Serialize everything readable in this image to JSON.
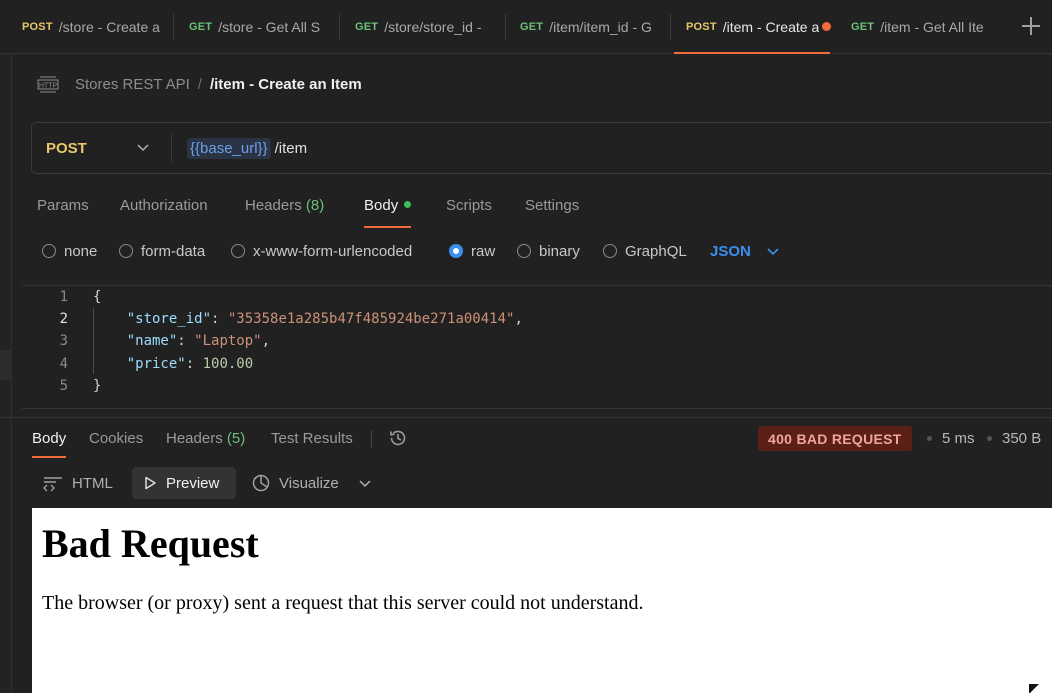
{
  "tabs": [
    {
      "method": "POST",
      "title": "/store - Create a",
      "active": false,
      "unsaved": false
    },
    {
      "method": "GET",
      "title": "/store - Get All S",
      "active": false,
      "unsaved": false
    },
    {
      "method": "GET",
      "title": "/store/store_id -",
      "active": false,
      "unsaved": false
    },
    {
      "method": "GET",
      "title": "/item/item_id - G",
      "active": false,
      "unsaved": false
    },
    {
      "method": "POST",
      "title": "/item - Create a",
      "active": true,
      "unsaved": true
    },
    {
      "method": "GET",
      "title": "/item - Get All Ite",
      "active": false,
      "unsaved": false
    }
  ],
  "breadcrumb": {
    "icon": "http-icon",
    "collection": "Stores REST API",
    "separator": "/",
    "request": "/item - Create an Item"
  },
  "request": {
    "method": "POST",
    "url_variable": "{{base_url}}",
    "url_path": "/item"
  },
  "request_tabs": [
    {
      "label": "Params"
    },
    {
      "label": "Authorization"
    },
    {
      "label": "Headers",
      "count": "(8)"
    },
    {
      "label": "Body",
      "active": true,
      "indicator": true
    },
    {
      "label": "Scripts"
    },
    {
      "label": "Settings"
    }
  ],
  "body_types": [
    {
      "label": "none",
      "selected": false
    },
    {
      "label": "form-data",
      "selected": false
    },
    {
      "label": "x-www-form-urlencoded",
      "selected": false
    },
    {
      "label": "raw",
      "selected": true
    },
    {
      "label": "binary",
      "selected": false
    },
    {
      "label": "GraphQL",
      "selected": false
    }
  ],
  "raw_format": "JSON",
  "editor": {
    "line_numbers": [
      "1",
      "2",
      "3",
      "4",
      "5"
    ],
    "lines": {
      "l1": "{",
      "l2_key": "\"store_id\"",
      "l2_colon": ": ",
      "l2_val": "\"35358e1a285b47f485924be271a00414\"",
      "l2_comma": ",",
      "l3_key": "\"name\"",
      "l3_colon": ": ",
      "l3_val": "\"Laptop\"",
      "l3_comma": ",",
      "l4_key": "\"price\"",
      "l4_colon": ": ",
      "l4_val": "100.00",
      "l5": "}"
    }
  },
  "response_tabs": [
    {
      "label": "Body",
      "active": true
    },
    {
      "label": "Cookies"
    },
    {
      "label": "Headers",
      "count": "(5)"
    },
    {
      "label": "Test Results"
    }
  ],
  "response_status": {
    "status": "400 BAD REQUEST",
    "time": "5 ms",
    "size": "350 B"
  },
  "view_modes": [
    {
      "label": "HTML",
      "icon": "code-format-icon"
    },
    {
      "label": "Preview",
      "icon": "play-icon",
      "selected": true
    },
    {
      "label": "Visualize",
      "icon": "visualize-icon"
    }
  ],
  "preview": {
    "heading": "Bad Request",
    "message": "The browser (or proxy) sent a request that this server could not understand."
  },
  "colors": {
    "accent": "#f36b3c",
    "post": "#e8c76a",
    "get": "#6bbf7a",
    "selected_radio": "#3a8ef0",
    "status_error_bg": "#5a1f17"
  }
}
